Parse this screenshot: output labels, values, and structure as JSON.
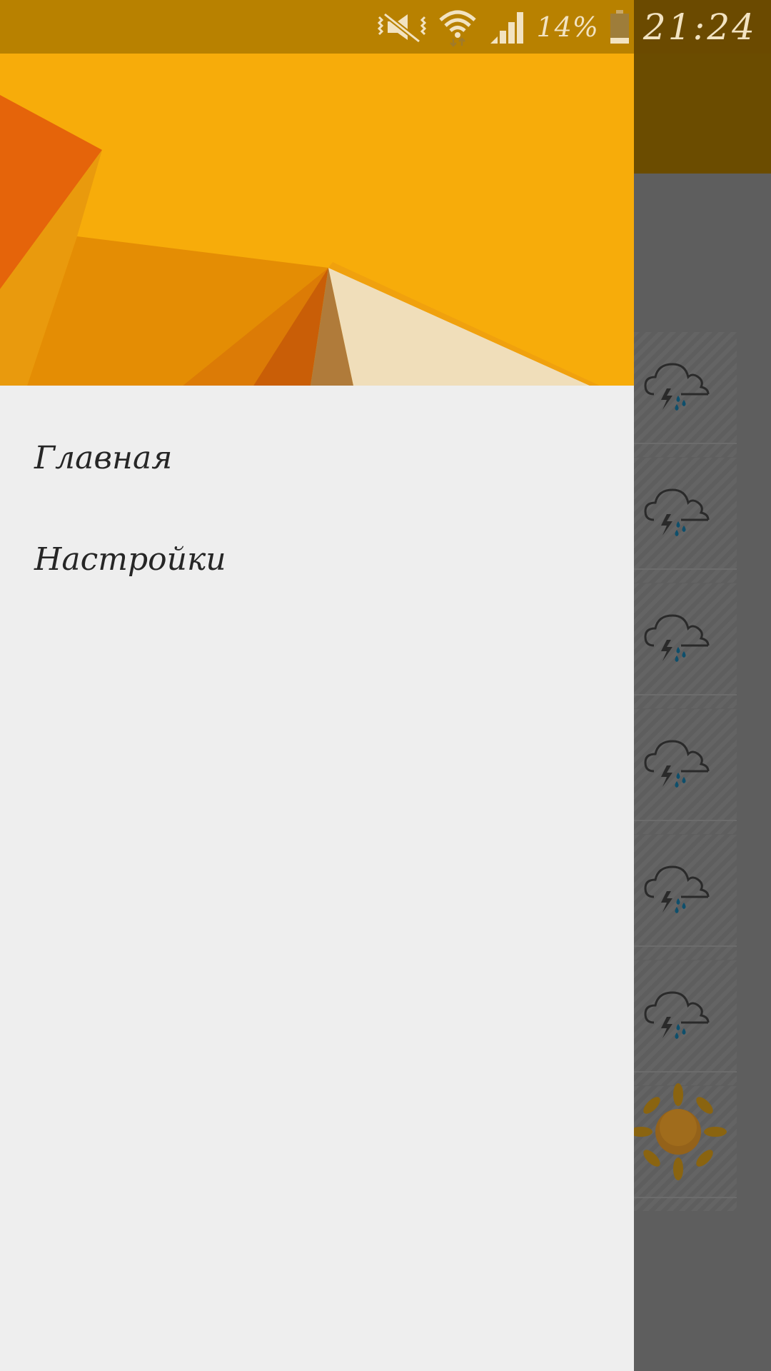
{
  "status_bar": {
    "battery_percent": "14%",
    "time": "21:24",
    "icons": [
      "vibrate-muted-icon",
      "wifi-icon",
      "signal-icon",
      "battery-icon"
    ]
  },
  "drawer": {
    "header_image": "orange-geometric-wallpaper",
    "menu": [
      {
        "label": "Главная"
      },
      {
        "label": "Настройки"
      }
    ]
  },
  "background_app": {
    "forecast_icons": [
      "thunderstorm-rain-icon",
      "thunderstorm-rain-icon",
      "thunderstorm-rain-icon",
      "thunderstorm-rain-icon",
      "thunderstorm-rain-icon",
      "thunderstorm-rain-icon",
      "sun-icon"
    ]
  },
  "colors": {
    "accent": "#f7ac0a",
    "status_bar": "#b88100",
    "drawer_background": "#eeeeee",
    "scrim": "#5e5e5e"
  }
}
